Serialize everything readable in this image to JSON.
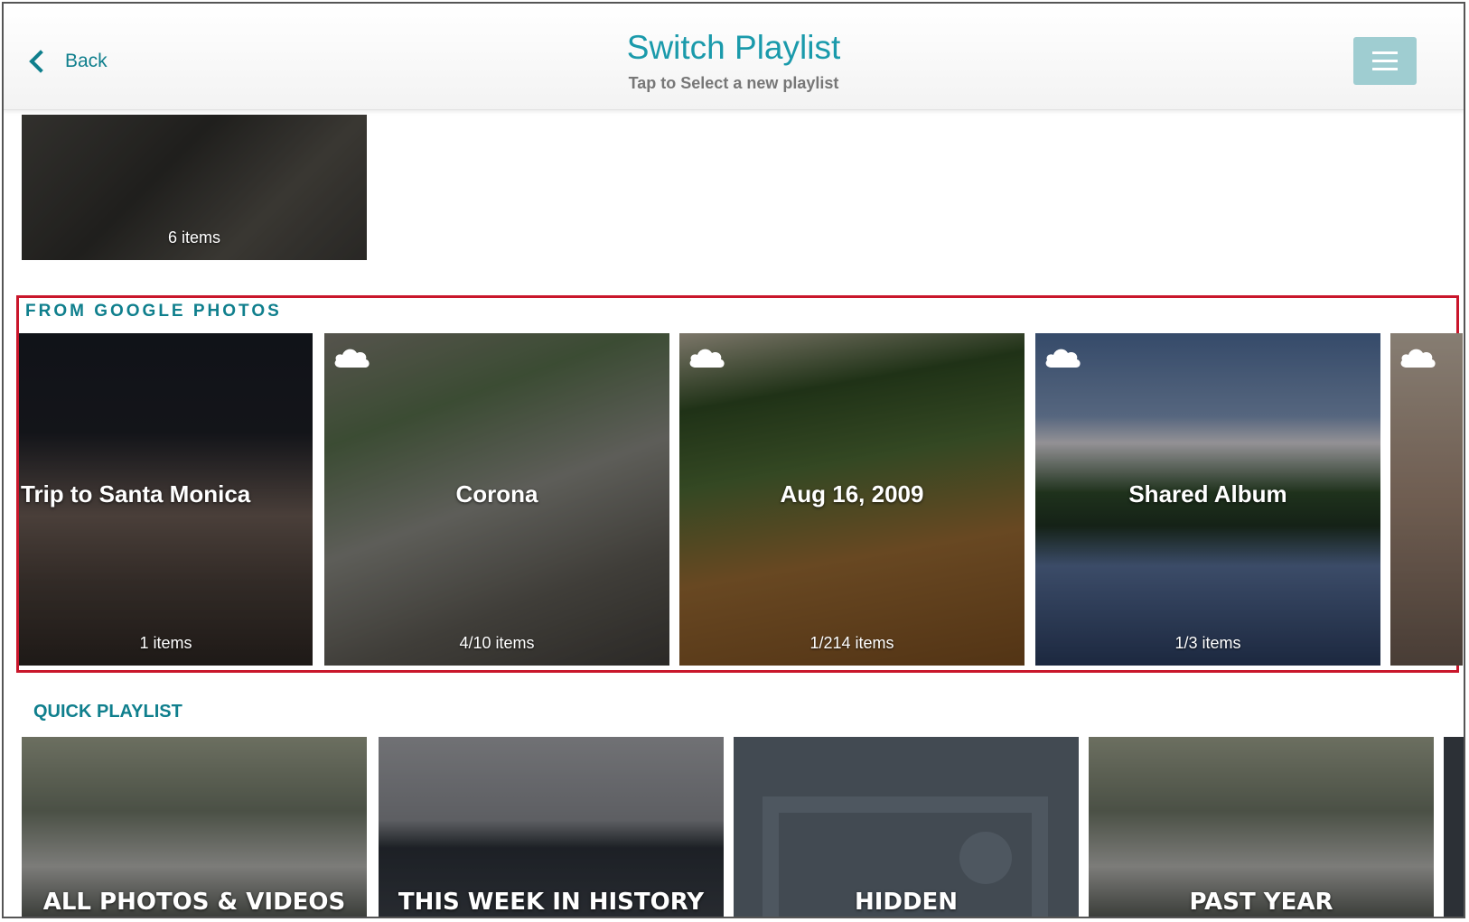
{
  "header": {
    "back_label": "Back",
    "title": "Switch Playlist",
    "subtitle": "Tap to Select a new playlist"
  },
  "top_tile": {
    "count": "6 items"
  },
  "google_photos": {
    "label": "FROM GOOGLE PHOTOS",
    "items": [
      {
        "name": "Trip to Santa Monica",
        "count": "1 items"
      },
      {
        "name": "Corona",
        "count": "4/10 items"
      },
      {
        "name": "Aug 16, 2009",
        "count": "1/214 items"
      },
      {
        "name": "Shared Album",
        "count": "1/3 items"
      }
    ]
  },
  "quick_playlist": {
    "label": "QUICK PLAYLIST",
    "items": [
      {
        "name": "ALL PHOTOS & VIDEOS"
      },
      {
        "name": "THIS WEEK IN HISTORY"
      },
      {
        "name": "HIDDEN"
      },
      {
        "name": "PAST YEAR"
      }
    ]
  },
  "colors": {
    "accent": "#1a9aab",
    "section_label": "#0f7f8d",
    "highlight_border": "#c9162b",
    "menu_button": "#9fcdd1"
  }
}
